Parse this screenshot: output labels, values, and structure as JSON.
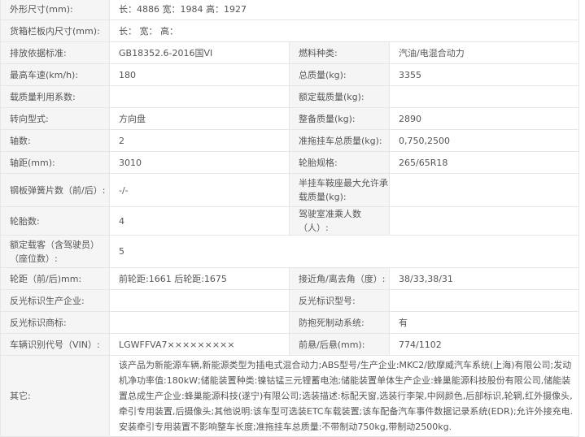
{
  "rows": [
    {
      "cells": [
        {
          "label": "外形尺寸(mm):",
          "value": "长：4886 宽：1984 高：1927",
          "span": true
        }
      ]
    },
    {
      "cells": [
        {
          "label": "货箱栏板内尺寸(mm):",
          "value": "长：  宽：  高：",
          "span": true
        }
      ]
    },
    {
      "cells": [
        {
          "label": "排放依据标准:",
          "value": "GB18352.6-2016国VI"
        },
        {
          "label": "燃料种类:",
          "value": "汽油/电混合动力"
        }
      ]
    },
    {
      "cells": [
        {
          "label": "最高车速(km/h):",
          "value": "180"
        },
        {
          "label": "总质量(kg):",
          "value": "3355"
        }
      ]
    },
    {
      "cells": [
        {
          "label": "载质量利用系数:",
          "value": ""
        },
        {
          "label": "额定载质量(kg):",
          "value": ""
        }
      ]
    },
    {
      "cells": [
        {
          "label": "转向型式:",
          "value": "方向盘"
        },
        {
          "label": "整备质量(kg):",
          "value": "2890"
        }
      ]
    },
    {
      "cells": [
        {
          "label": "轴数:",
          "value": "2"
        },
        {
          "label": "准拖挂车总质量(kg):",
          "value": "0,750,2500"
        }
      ]
    },
    {
      "cells": [
        {
          "label": "轴距(mm):",
          "value": "3010"
        },
        {
          "label": "轮胎规格:",
          "value": "265/65R18"
        }
      ]
    },
    {
      "cells": [
        {
          "label": "钢板弹簧片数（前/后）:",
          "value": "-/-"
        },
        {
          "label": "半挂车鞍座最大允许承载质量(kg):",
          "value": ""
        }
      ],
      "h": 41
    },
    {
      "cells": [
        {
          "label": "轮胎数:",
          "value": "4"
        },
        {
          "label": "驾驶室准乘人数（人）:",
          "value": ""
        }
      ]
    },
    {
      "cells": [
        {
          "label": "额定载客（含驾驶员）（座位数）:",
          "value": "5",
          "span": true
        }
      ],
      "h": 40
    },
    {
      "cells": [
        {
          "label": "轮距（前/后)mm:",
          "value": "前轮距:1661 后轮距:1675"
        },
        {
          "label": "接近角/离去角（度）:",
          "value": "38/33,38/31"
        }
      ]
    },
    {
      "cells": [
        {
          "label": "反光标识生产企业:",
          "value": ""
        },
        {
          "label": "反光标识型号:",
          "value": ""
        }
      ]
    },
    {
      "cells": [
        {
          "label": "反光标识商标:",
          "value": ""
        },
        {
          "label": "防抱死制动系统:",
          "value": "有"
        }
      ]
    },
    {
      "cells": [
        {
          "label": "车辆识别代号（VIN）:",
          "value": "LGWFFVA7×××××××××"
        },
        {
          "label": "前悬/后悬(mm):",
          "value": "774/1102"
        }
      ]
    },
    {
      "cells": [
        {
          "label": "其它:",
          "value": "该产品为新能源车辆,新能源类型为插电式混合动力;ABS型号/生产企业:MKC2/欧摩威汽车系统(上海)有限公司;发动机净功率值:180kW;储能装置种类:镍钴锰三元锂蓄电池;储能装置单体生产企业:蜂巢能源科技股份有限公司,储能装置总成生产企业:蜂巢能源科技(遂宁)有限公司;选装描述:标配天窗,选装行李架,中网颜色,后部标识,轮辋,红外摄像头,牵引专用装置,后摄像头;其他说明:该车型可选装ETC车载装置;该车配备汽车事件数据记录系统(EDR);允许外接充电.安装牵引专用装置不影响整车长度;准拖挂车总质量:不带制动750kg,带制动2500kg.",
          "span": true,
          "other": true
        }
      ]
    }
  ]
}
